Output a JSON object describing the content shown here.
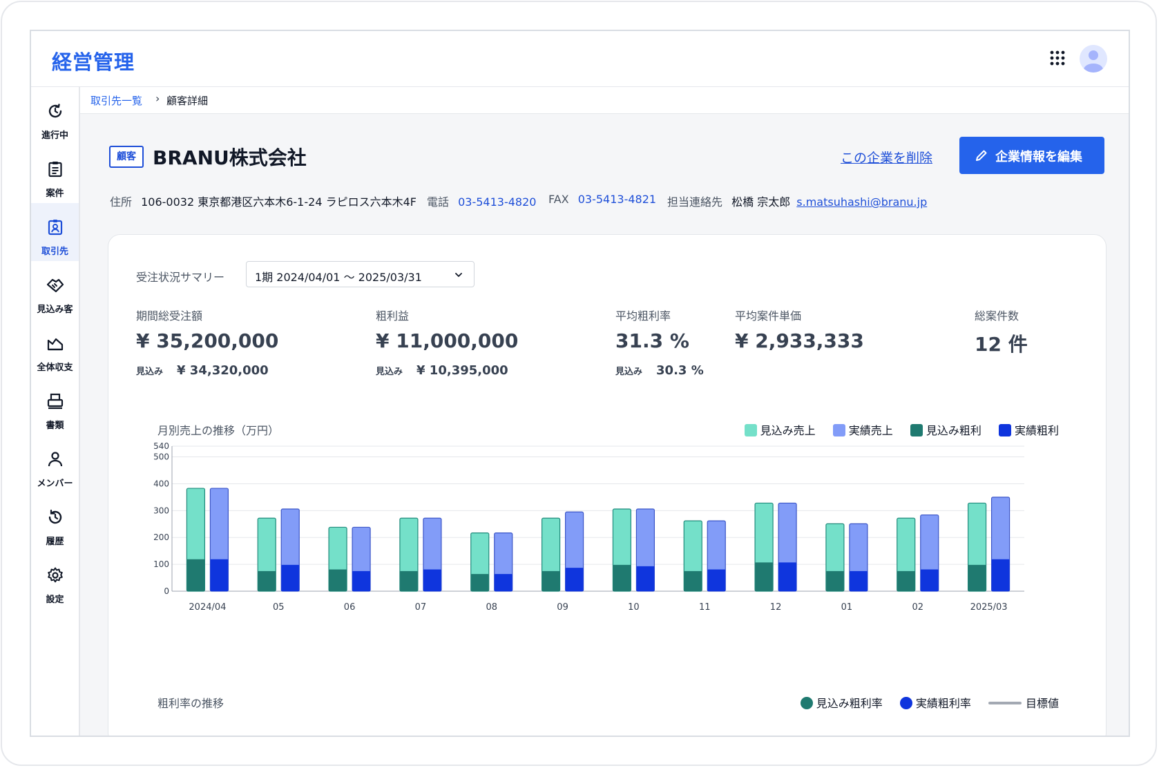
{
  "app": {
    "title": "経営管理"
  },
  "header": {
    "apps_icon": "grid-icon",
    "avatar_icon": "user-avatar"
  },
  "sidebar": {
    "items": [
      {
        "label": "進行中",
        "icon": "progress-icon",
        "active": false
      },
      {
        "label": "案件",
        "icon": "clipboard-icon",
        "active": false
      },
      {
        "label": "取引先",
        "icon": "contact-badge-icon",
        "active": true
      },
      {
        "label": "見込み客",
        "icon": "handshake-icon",
        "active": false
      },
      {
        "label": "全体収支",
        "icon": "chart-area-icon",
        "active": false
      },
      {
        "label": "書類",
        "icon": "printer-icon",
        "active": false
      },
      {
        "label": "メンバー",
        "icon": "person-icon",
        "active": false
      },
      {
        "label": "履歴",
        "icon": "history-icon",
        "active": false
      },
      {
        "label": "設定",
        "icon": "gear-icon",
        "active": false
      }
    ]
  },
  "breadcrumb": {
    "parent": "取引先一覧",
    "separator": "›",
    "current": "顧客詳細"
  },
  "company": {
    "badge": "顧客",
    "name": "BRANU株式会社",
    "delete_label": "この企業を削除",
    "edit_label": "企業情報を編集",
    "address_label": "住所",
    "address": "106-0032 東京都港区六本木6-1-24 ラピロス六本木4F",
    "phone_label": "電話",
    "phone": "03-5413-4820",
    "fax_label": "FAX",
    "fax": "03-5413-4821",
    "contact_label": "担当連絡先",
    "contact_name": "松橋 宗太郎",
    "contact_email": "s.matsuhashi@branu.jp"
  },
  "summary": {
    "label": "受注状況サマリー",
    "period": "1期 2024/04/01 〜 2025/03/31",
    "kpis": {
      "total_orders": {
        "label": "期間総受注額",
        "value": "¥ 35,200,000",
        "sub_label": "見込み",
        "sub_value": "¥ 34,320,000"
      },
      "gross_profit": {
        "label": "粗利益",
        "value": "¥ 11,000,000",
        "sub_label": "見込み",
        "sub_value": "¥ 10,395,000"
      },
      "avg_margin": {
        "label": "平均粗利率",
        "value": "31.3 %",
        "sub_label": "見込み",
        "sub_value": "30.3 %"
      },
      "avg_unit_price": {
        "label": "平均案件単価",
        "value": "¥ 2,933,333"
      },
      "total_cases": {
        "label": "総案件数",
        "value": "12 件"
      }
    }
  },
  "chart_data": [
    {
      "type": "bar",
      "title": "月別売上の推移（万円）",
      "categories": [
        "2024/04",
        "05",
        "06",
        "07",
        "08",
        "09",
        "10",
        "11",
        "12",
        "01",
        "02",
        "2025/03"
      ],
      "yticks": [
        0,
        100,
        200,
        300,
        400,
        500,
        540
      ],
      "ylim": [
        0,
        540
      ],
      "grid": true,
      "legend_position": "top-right",
      "series": [
        {
          "name": "見込み売上",
          "color": "#74e0c9",
          "stroke": "#1f8a7b",
          "values": [
            383,
            272,
            238,
            272,
            217,
            272,
            306,
            262,
            328,
            251,
            272,
            328
          ]
        },
        {
          "name": "実績売上",
          "color": "#829cf8",
          "stroke": "#3b55c7",
          "values": [
            383,
            306,
            238,
            272,
            217,
            295,
            306,
            262,
            328,
            251,
            284,
            350
          ]
        },
        {
          "name": "見込み粗利",
          "color": "#1f7a70",
          "values": [
            119,
            75,
            81,
            75,
            64,
            75,
            98,
            75,
            107,
            75,
            75,
            98
          ]
        },
        {
          "name": "実績粗利",
          "color": "#0f35dd",
          "values": [
            119,
            98,
            75,
            81,
            64,
            87,
            93,
            81,
            107,
            75,
            81,
            119
          ]
        }
      ]
    },
    {
      "type": "line",
      "title": "粗利率の推移",
      "legend_position": "top-right",
      "series": [
        {
          "name": "見込み粗利率",
          "color": "#1f7a70"
        },
        {
          "name": "実績粗利率",
          "color": "#0f35dd"
        },
        {
          "name": "目標値",
          "color": "#a3a9b3"
        }
      ]
    }
  ]
}
